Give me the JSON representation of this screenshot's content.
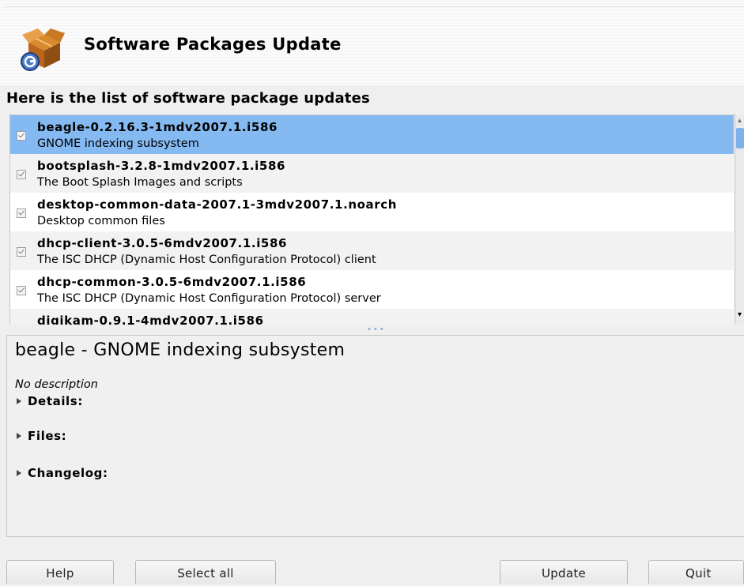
{
  "header": {
    "title": "Software Packages Update",
    "icon": "package-update-icon"
  },
  "section_label": "Here is the list of software package updates",
  "packages": [
    {
      "name": "beagle-0.2.16.3-1mdv2007.1.i586",
      "description": "GNOME indexing subsystem",
      "checked": true,
      "selected": true
    },
    {
      "name": "bootsplash-3.2.8-1mdv2007.1.i586",
      "description": "The Boot Splash Images and scripts",
      "checked": true,
      "selected": false
    },
    {
      "name": "desktop-common-data-2007.1-3mdv2007.1.noarch",
      "description": "Desktop common files",
      "checked": true,
      "selected": false
    },
    {
      "name": "dhcp-client-3.0.5-6mdv2007.1.i586",
      "description": "The ISC DHCP (Dynamic Host Configuration Protocol) client",
      "checked": true,
      "selected": false
    },
    {
      "name": "dhcp-common-3.0.5-6mdv2007.1.i586",
      "description": "The ISC DHCP (Dynamic Host Configuration Protocol) server",
      "checked": true,
      "selected": false
    },
    {
      "name": "digikam-0.9.1-4mdv2007.1.i586",
      "description": "",
      "checked": true,
      "selected": false
    }
  ],
  "details": {
    "title": "beagle - GNOME indexing subsystem",
    "description": "No description",
    "expanders": [
      "Details:",
      "Files:",
      "Changelog:"
    ]
  },
  "buttons": {
    "help": "Help",
    "select_all": "Select all",
    "update": "Update",
    "quit": "Quit"
  },
  "colors": {
    "selection": "#84b9f1",
    "scroll_thumb": "#7fb2ea"
  }
}
